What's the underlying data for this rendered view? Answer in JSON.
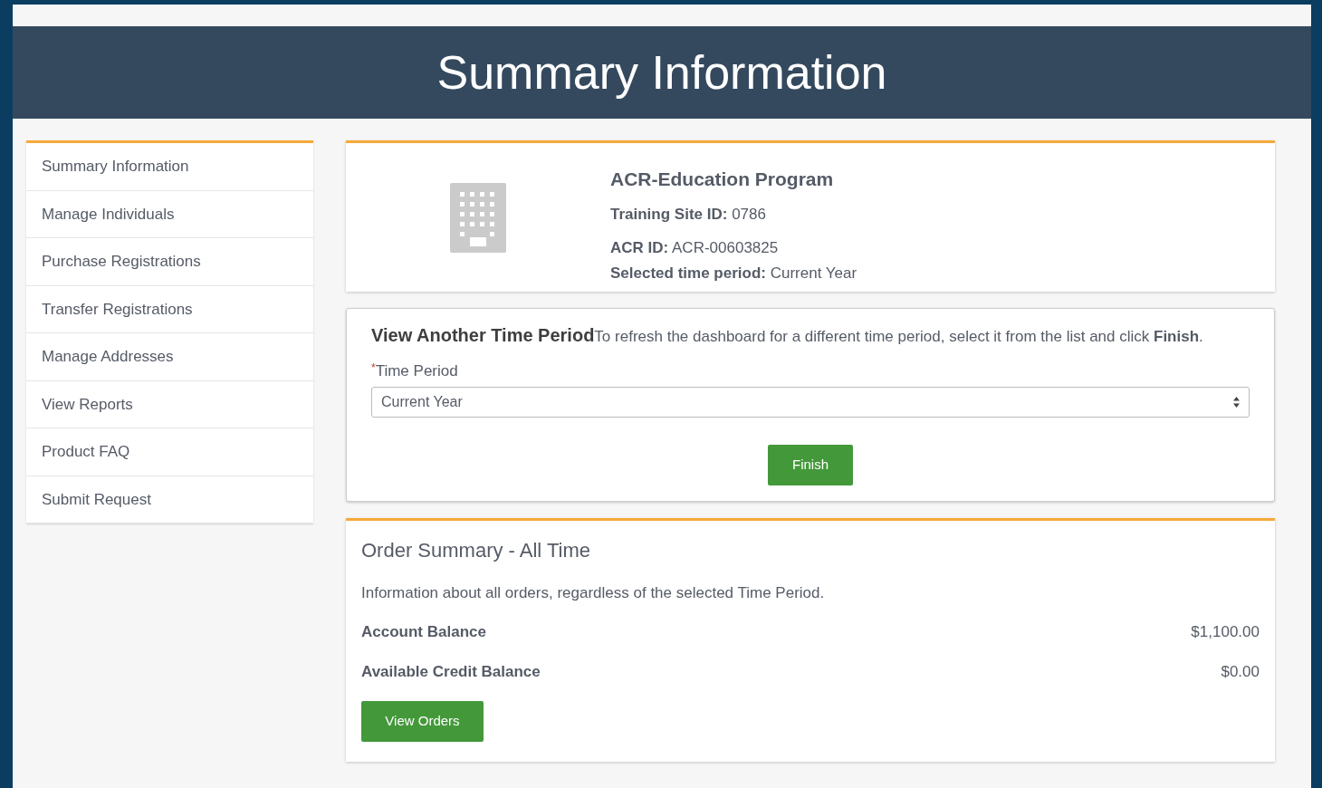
{
  "header": {
    "title": "Summary Information"
  },
  "sidebar": {
    "items": [
      {
        "label": "Summary Information"
      },
      {
        "label": "Manage Individuals"
      },
      {
        "label": "Purchase Registrations"
      },
      {
        "label": "Transfer Registrations"
      },
      {
        "label": "Manage Addresses"
      },
      {
        "label": "View Reports"
      },
      {
        "label": "Product FAQ"
      },
      {
        "label": "Submit Request"
      }
    ]
  },
  "site_card": {
    "title": "ACR-Education Program",
    "fields": [
      {
        "label": "Training Site ID:",
        "value": "0786"
      },
      {
        "label": "ACR ID:",
        "value": "ACR-00603825"
      },
      {
        "label": "Selected time period:",
        "value": "Current Year"
      }
    ]
  },
  "time_period_card": {
    "title": "View Another Time Period",
    "instructions": "To refresh the dashboard for a different time period, select it from the list and click **Finish**.",
    "field": {
      "required_mark": "*",
      "label": "Time Period",
      "value": "Current Year"
    },
    "button": "Finish"
  },
  "order_summary": {
    "title": "Order Summary - All Time",
    "description": "Information about all orders, regardless of the selected Time Period.",
    "rows": [
      {
        "label": "Account Balance",
        "value": "$1,100.00"
      },
      {
        "label": "Available Credit Balance",
        "value": "$0.00"
      }
    ],
    "button": "View Orders"
  }
}
